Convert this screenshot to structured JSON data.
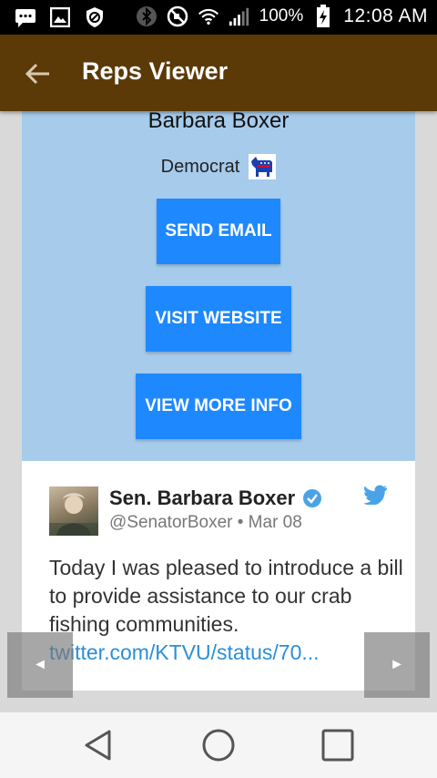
{
  "status_bar": {
    "battery_pct": "100%",
    "time": "12:08 AM",
    "icons": [
      "chat-bubble-icon",
      "image-icon",
      "shield-icon",
      "bluetooth-icon",
      "do-not-disturb-icon",
      "wifi-icon",
      "signal-icon",
      "battery-charging-icon"
    ]
  },
  "app_bar": {
    "title": "Reps Viewer",
    "back_icon": "arrow-left-icon",
    "color": "#5b3a08"
  },
  "rep": {
    "name": "Barbara Boxer",
    "party": "Democrat",
    "party_icon": "democrat-donkey-icon",
    "card_color": "#a6cbeb"
  },
  "actions": {
    "send_email": "SEND EMAIL",
    "visit_website": "VISIT WEBSITE",
    "view_more_info": "VIEW MORE INFO",
    "button_color": "#1e88ff"
  },
  "tweet": {
    "author": "Sen. Barbara Boxer",
    "meta": "@SenatorBoxer • Mar 08",
    "text": "Today I was pleased to introduce a bill to provide assistance to our crab fishing communities.",
    "link": "twitter.com/KTVU/status/70...",
    "link_color": "#2a8fd8"
  },
  "pager": {
    "prev": "◄",
    "next": "►"
  },
  "nav_bar": {
    "icons": [
      "back-triangle-icon",
      "home-circle-icon",
      "recents-square-icon"
    ]
  }
}
